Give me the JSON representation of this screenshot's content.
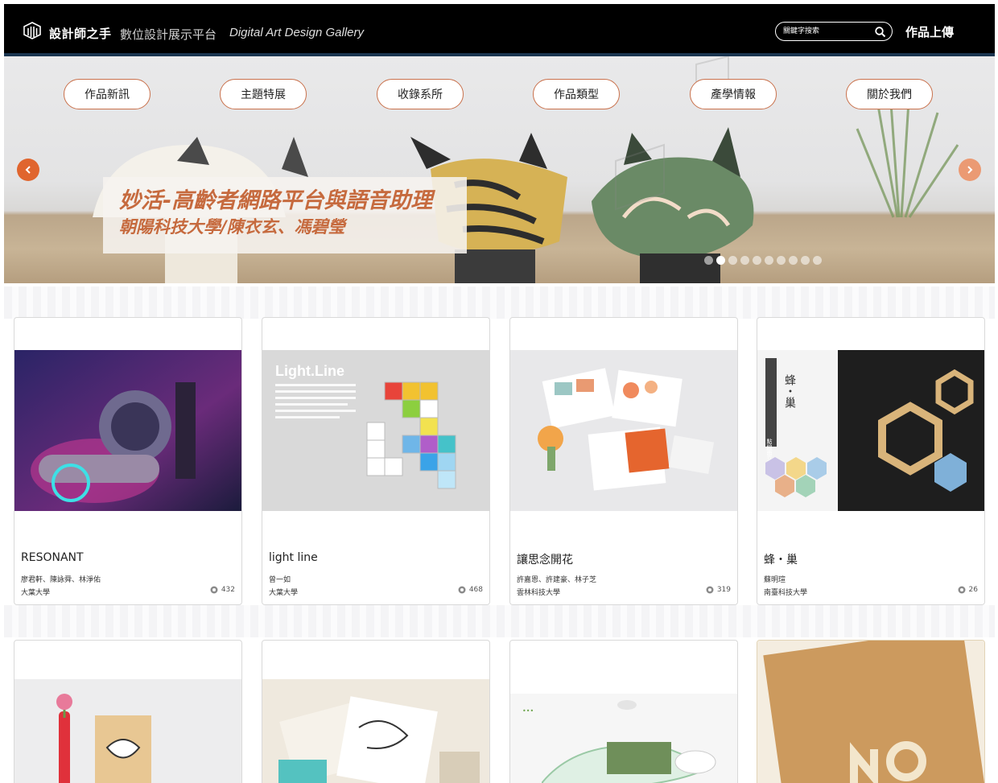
{
  "header": {
    "title": "設計師之手",
    "subtitle": "數位設計展示平台",
    "english": "Digital Art Design Gallery",
    "search_placeholder": "關鍵字搜索",
    "upload_label": "作品上傳"
  },
  "nav": {
    "items": [
      {
        "label": "作品新訊"
      },
      {
        "label": "主題特展"
      },
      {
        "label": "收錄系所"
      },
      {
        "label": "作品類型"
      },
      {
        "label": "產學情報"
      },
      {
        "label": "關於我們"
      }
    ]
  },
  "hero": {
    "title": "妙活-高齡者網路平台與語音助理",
    "subtitle": "朝陽科技大學/陳衣玄、馮碧瑩",
    "slide_count": 10,
    "active_slide": 2
  },
  "cards": [
    {
      "title": "RESONANT",
      "authors": "廖君軒、陳詠舜、林淨佑",
      "school": "大葉大學",
      "views": "432"
    },
    {
      "title": "light line",
      "authors": "曾一如",
      "school": "大葉大學",
      "views": "468"
    },
    {
      "title": "讓思念開花",
      "authors": "許嘉恩、許建豪、林子芝",
      "school": "雲林科技大學",
      "views": "319"
    },
    {
      "title": "蜂・巢",
      "authors": "蘇明瑄",
      "school": "南臺科技大學",
      "views": "26"
    }
  ],
  "card_art": {
    "lightline_heading": "Light.Line",
    "honeycomb_heading": "蜂・巢",
    "honeycomb_side": "點線面立體"
  },
  "colors": {
    "accent": "#e0652e",
    "caption_text": "#c66a3e",
    "topbar": "#000000"
  }
}
